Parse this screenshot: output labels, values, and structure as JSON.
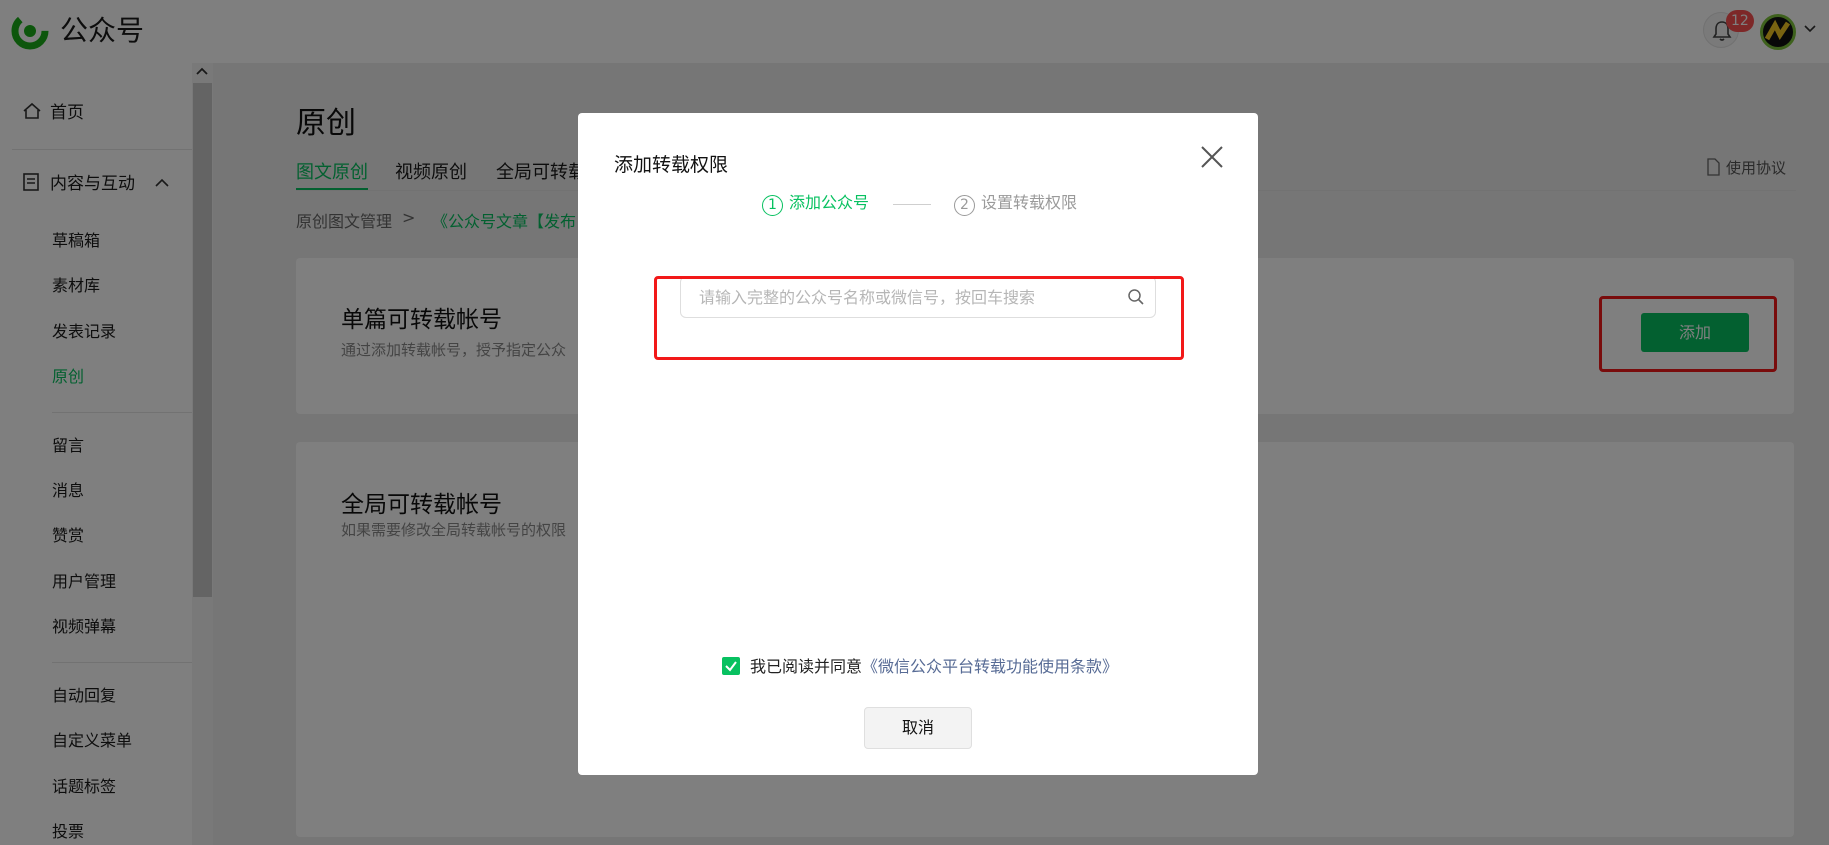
{
  "app": {
    "name": "公众号",
    "logo_icon": "wechat-official-account-logo",
    "notification_count": "12",
    "accent": "#07c160"
  },
  "sidebar": {
    "home": "首页",
    "content_section": "内容与互动",
    "items_group1": [
      "草稿箱",
      "素材库",
      "发表记录",
      "原创"
    ],
    "items_group2": [
      "留言",
      "消息",
      "赞赏",
      "用户管理",
      "视频弹幕"
    ],
    "items_group3": [
      "自动回复",
      "自定义菜单",
      "话题标签",
      "投票"
    ],
    "active_item": "原创"
  },
  "main": {
    "title": "原创",
    "tabs": [
      "图文原创",
      "视频原创",
      "全局可转载"
    ],
    "agreement": "使用协议",
    "breadcrumb": {
      "root": "原创图文管理",
      "separator": ">",
      "current": "《公众号文章【发布"
    },
    "single_card": {
      "title": "单篇可转载帐号",
      "desc": "通过添加转载帐号，授予指定公众",
      "add_button": "添加"
    },
    "global_card": {
      "title": "全局可转载帐号",
      "desc": "如果需要修改全局转载帐号的权限"
    }
  },
  "dialog": {
    "title": "添加转载权限",
    "steps": [
      {
        "num": "1",
        "label": "添加公众号"
      },
      {
        "num": "2",
        "label": "设置转载权限"
      }
    ],
    "search": {
      "placeholder": "请输入完整的公众号名称或微信号，按回车搜索",
      "value": ""
    },
    "agree_prefix": "我已阅读并同意",
    "agree_link": "《微信公众平台转载功能使用条款》",
    "agree_checked": true,
    "cancel": "取消"
  }
}
